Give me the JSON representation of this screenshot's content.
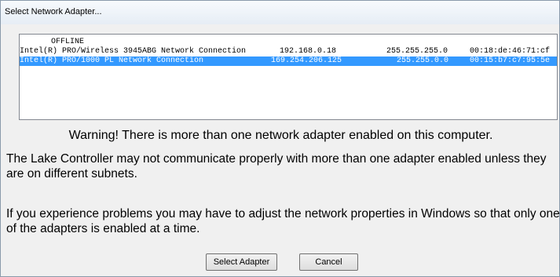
{
  "window": {
    "title": "Select Network Adapter..."
  },
  "adapter_list": {
    "header_status": "OFFLINE",
    "rows": [
      {
        "name": "Intel(R) PRO/Wireless 3945ABG Network Connection",
        "ip": "192.168.0.18",
        "mask": "255.255.255.0",
        "mac": "00:18:de:46:71:cf",
        "selected": false
      },
      {
        "name": "Intel(R) PRO/1000 PL Network Connection",
        "ip": "169.254.206.125",
        "mask": "255.255.0.0",
        "mac": "00:15:b7:c7:95:5e",
        "selected": true
      }
    ]
  },
  "messages": {
    "warning": "Warning!  There is more than one network adapter enabled on this computer.",
    "paragraph1": "The Lake Controller may not communicate properly with more than one adapter enabled unless they are on different subnets.",
    "paragraph2": "If you experience problems you may have to adjust the network properties in Windows so that only one of the adapters is enabled at a time."
  },
  "buttons": {
    "select_label": "Select Adapter",
    "cancel_label": "Cancel"
  },
  "colors": {
    "selection": "#3399ff",
    "window_bg": "#f0f0f0"
  }
}
